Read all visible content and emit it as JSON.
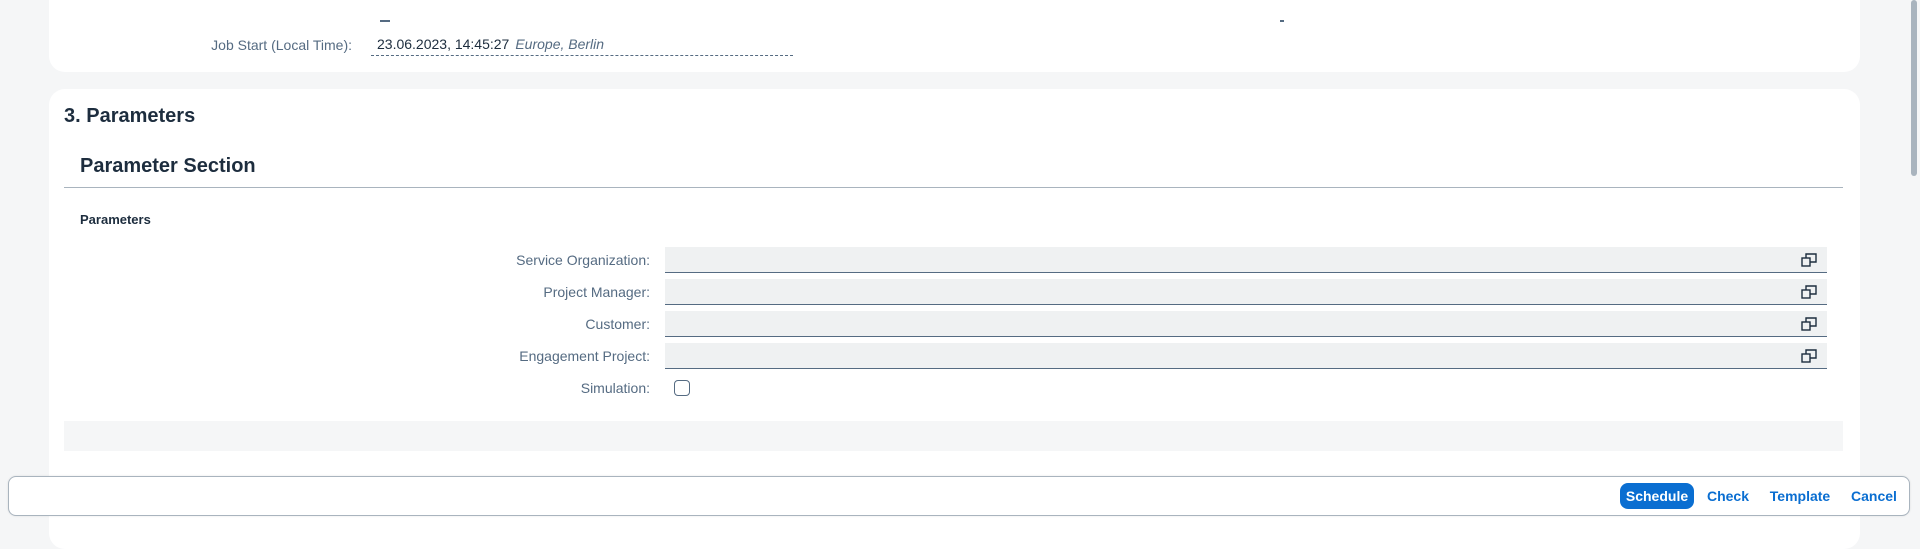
{
  "job": {
    "label": "Job Start (Local Time):",
    "value": "23.06.2023, 14:45:27",
    "timezone": "Europe, Berlin"
  },
  "section": {
    "title": "3. Parameters",
    "subsection_title": "Parameter Section",
    "group_title": "Parameters"
  },
  "fields": {
    "service_org": {
      "label": "Service Organization:",
      "value": ""
    },
    "project_manager": {
      "label": "Project Manager:",
      "value": ""
    },
    "customer": {
      "label": "Customer:",
      "value": ""
    },
    "engagement_project": {
      "label": "Engagement Project:",
      "value": ""
    },
    "simulation": {
      "label": "Simulation:",
      "checked": false
    }
  },
  "footer": {
    "schedule": "Schedule",
    "check": "Check",
    "template": "Template",
    "cancel": "Cancel"
  },
  "icons": {
    "value_help": "value-help-icon"
  },
  "colors": {
    "accent": "#0a6ed1",
    "label": "#556b82",
    "text": "#1d2d3e",
    "input_bg": "#eff1f2",
    "page_bg": "#f5f6f7"
  }
}
